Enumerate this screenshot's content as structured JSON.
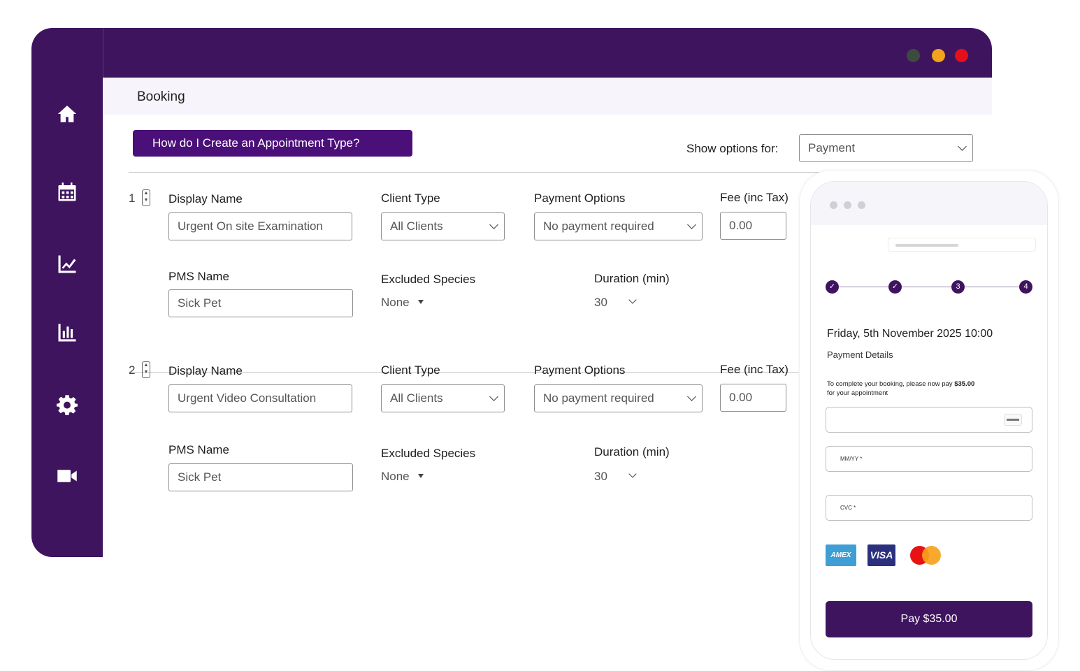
{
  "window": {
    "traffic_lights": [
      "#3d4a3f",
      "#f2a41e",
      "#e3101a"
    ],
    "accent": "#3f145f",
    "button_color": "#4a0f78"
  },
  "sidebar": {
    "icons": [
      "home-icon",
      "calendar-icon",
      "trend-chart-icon",
      "bar-chart-icon",
      "gear-icon",
      "video-camera-icon"
    ]
  },
  "header": {
    "title": "Booking"
  },
  "toolbar": {
    "help_button": "How do I Create an Appointment Type?",
    "show_options_label": "Show options for:",
    "show_options_value": "Payment"
  },
  "appointments": [
    {
      "number": "1",
      "display_name_label": "Display Name",
      "display_name": "Urgent On site Examination",
      "client_type_label": "Client Type",
      "client_type": "All Clients",
      "payment_options_label": "Payment Options",
      "payment_option": "No payment required",
      "fee_label": "Fee (inc Tax)",
      "fee": "0.00",
      "pms_name_label": "PMS Name",
      "pms_name": "Sick Pet",
      "excluded_species_label": "Excluded Species",
      "excluded_species": "None",
      "duration_label": "Duration (min)",
      "duration": "30"
    },
    {
      "number": "2",
      "display_name_label": "Display Name",
      "display_name": "Urgent Video Consultation",
      "client_type_label": "Client Type",
      "client_type": "All Clients",
      "payment_options_label": "Payment Options",
      "payment_option": "No payment required",
      "fee_label": "Fee (inc Tax)",
      "fee": "0.00",
      "pms_name_label": "PMS Name",
      "pms_name": "Sick Pet",
      "excluded_species_label": "Excluded Species",
      "excluded_species": "None",
      "duration_label": "Duration (min)",
      "duration": "30"
    }
  ],
  "phone": {
    "steps": [
      "✓",
      "✓",
      "3",
      "4"
    ],
    "date_time": "Friday, 5th November 2025 10:00",
    "section_title": "Payment Details",
    "note_prefix": "To complete your booking, please now pay ",
    "note_amount": "$35.00",
    "note_suffix": "for your appointment",
    "expiry_label": "MM/YY *",
    "cvc_label": "CVC *",
    "card_brands": [
      "AMEX",
      "VISA",
      "mastercard"
    ],
    "pay_button": "Pay $35.00"
  }
}
